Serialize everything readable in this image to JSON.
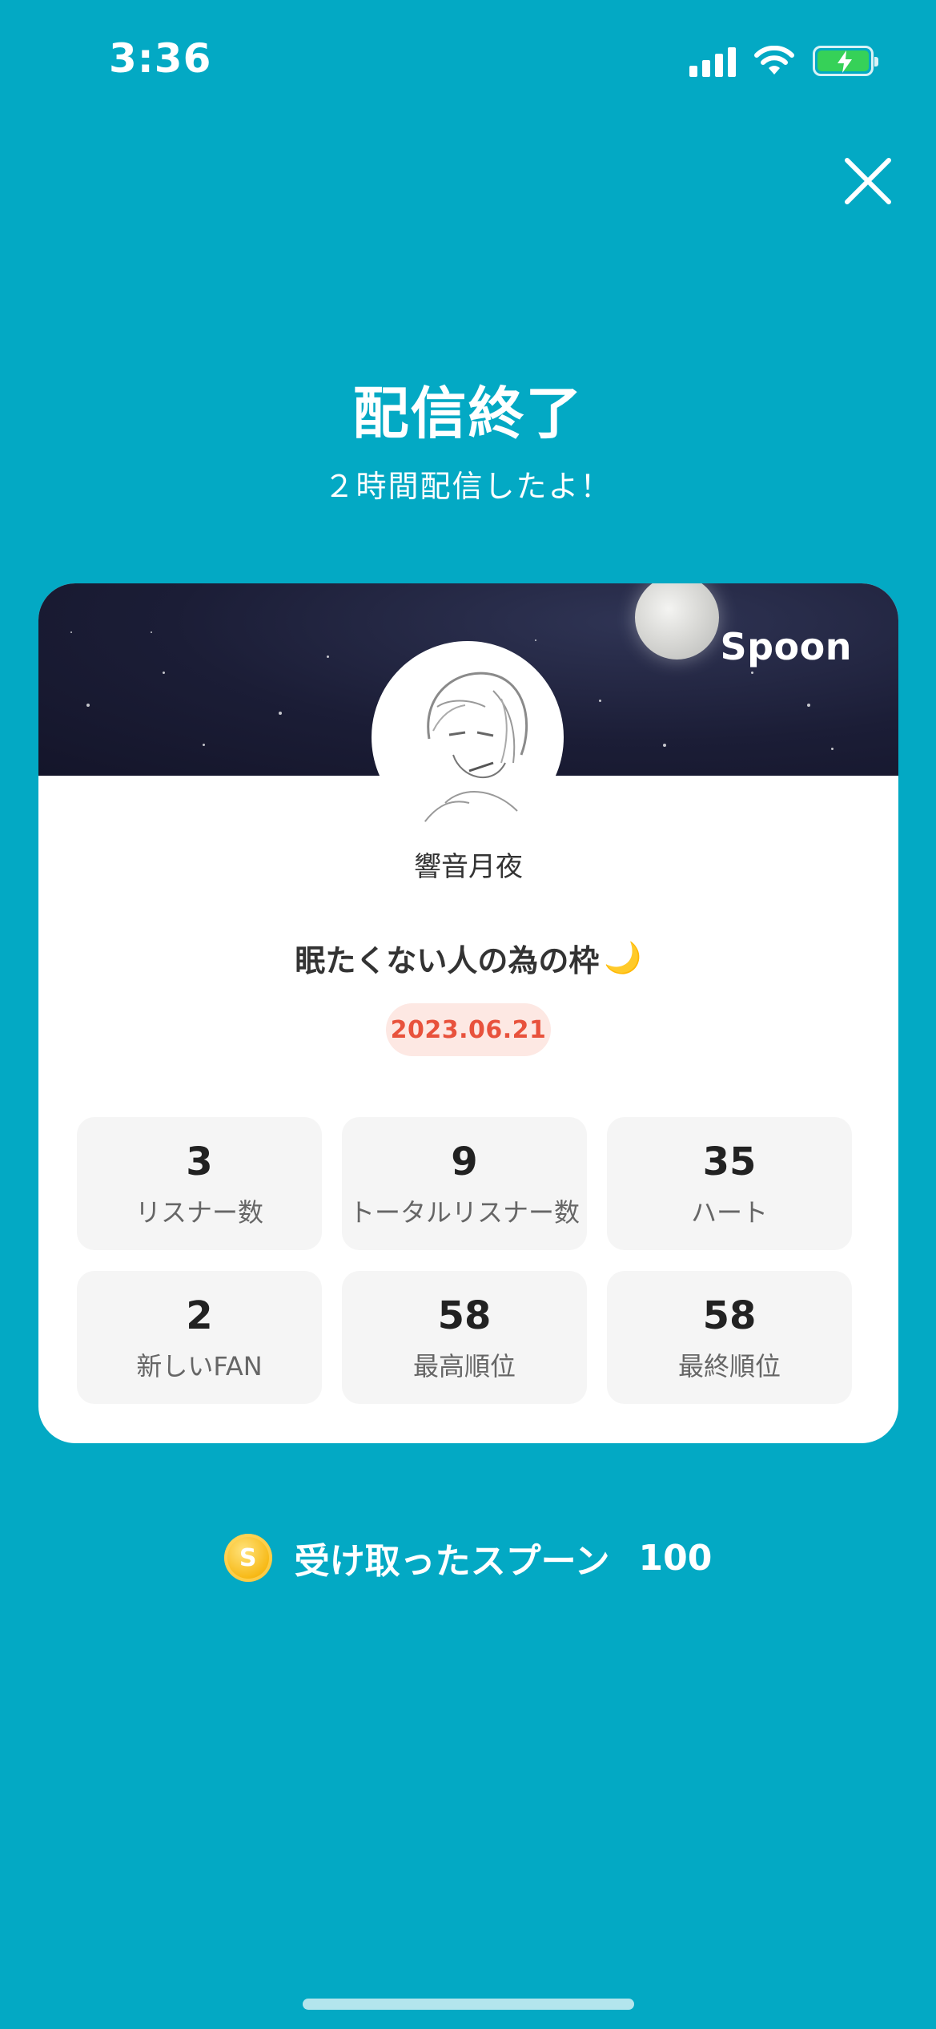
{
  "status_bar": {
    "time": "3:36"
  },
  "header": {
    "title": "配信終了",
    "subtitle": "２時間配信したよ！"
  },
  "card": {
    "brand": "Spoon",
    "username": "響音月夜",
    "stream_title": "眠たくない人の為の枠",
    "title_emoji": "🌙",
    "date": "2023.06.21",
    "stats": [
      {
        "value": "3",
        "label": "リスナー数"
      },
      {
        "value": "9",
        "label": "トータルリスナー数"
      },
      {
        "value": "35",
        "label": "ハート"
      },
      {
        "value": "2",
        "label": "新しいFAN"
      },
      {
        "value": "58",
        "label": "最高順位"
      },
      {
        "value": "58",
        "label": "最終順位"
      }
    ]
  },
  "spoons": {
    "coin_symbol": "S",
    "label": "受け取ったスプーン",
    "amount": "100"
  },
  "colors": {
    "background": "#03a9c4",
    "date_text": "#e8523c",
    "date_bg": "#fde8e3",
    "coin": "#f7b916"
  },
  "icons": {
    "close": "close-icon",
    "signal": "cellular-signal-icon",
    "wifi": "wifi-icon",
    "battery": "battery-charging-icon",
    "coin": "spoon-coin-icon"
  }
}
